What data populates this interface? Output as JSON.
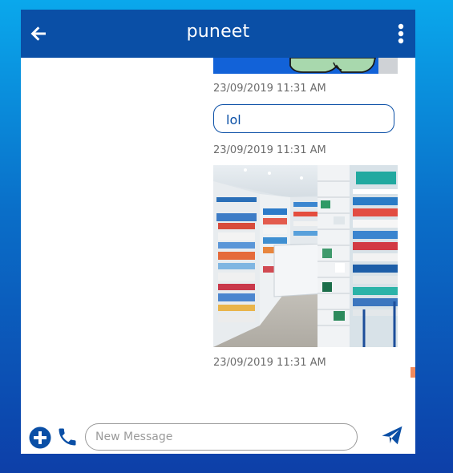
{
  "header": {
    "contact_name": "puneet",
    "back_icon": "arrow-left-icon",
    "menu_icon": "more-vertical-icon",
    "color": "#0a4fa6"
  },
  "messages": [
    {
      "type": "image",
      "description_icon": "sticker-image",
      "timestamp": "23/09/2019 11:31 AM"
    },
    {
      "type": "text",
      "text": "lol",
      "timestamp": "23/09/2019 11:31 AM"
    },
    {
      "type": "image",
      "description_icon": "pharmacy-photo",
      "timestamp": "23/09/2019 11:31 AM"
    }
  ],
  "composer": {
    "placeholder": "New Message",
    "value": "",
    "attach_icon": "plus-circle-icon",
    "call_icon": "phone-icon",
    "send_icon": "send-icon"
  },
  "colors": {
    "accent": "#0a4fa6",
    "timestamp": "#6d6d6d",
    "background_top": "#0aa8ec",
    "background_bottom": "#0d3fa8"
  }
}
